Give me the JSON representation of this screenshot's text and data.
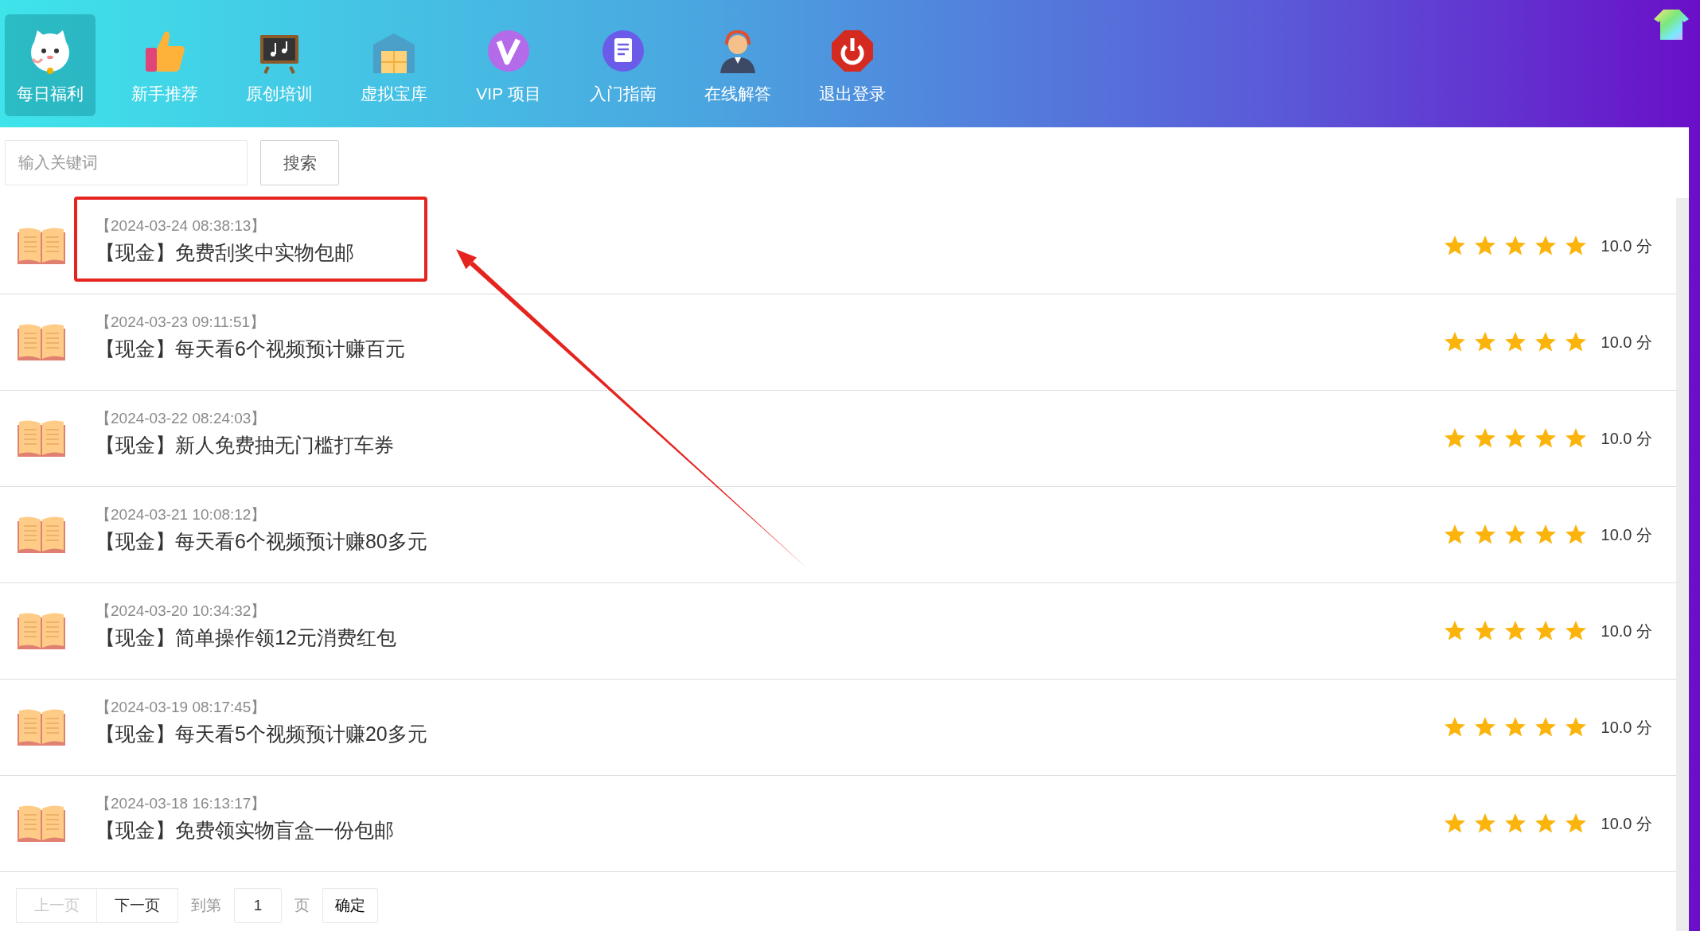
{
  "nav": {
    "items": [
      {
        "label": "每日福利",
        "selected": true
      },
      {
        "label": "新手推荐",
        "selected": false
      },
      {
        "label": "原创培训",
        "selected": false
      },
      {
        "label": "虚拟宝库",
        "selected": false
      },
      {
        "label": "VIP 项目",
        "selected": false
      },
      {
        "label": "入门指南",
        "selected": false
      },
      {
        "label": "在线解答",
        "selected": false
      },
      {
        "label": "退出登录",
        "selected": false
      }
    ]
  },
  "search": {
    "placeholder": "输入关键词",
    "button": "搜索"
  },
  "articles": [
    {
      "date": "【2024-03-24 08:38:13】",
      "title": "【现金】免费刮奖中实物包邮",
      "stars": 5,
      "score": "10.0 分",
      "highlighted": true
    },
    {
      "date": "【2024-03-23 09:11:51】",
      "title": "【现金】每天看6个视频预计赚百元",
      "stars": 5,
      "score": "10.0 分",
      "highlighted": false
    },
    {
      "date": "【2024-03-22 08:24:03】",
      "title": "【现金】新人免费抽无门槛打车券",
      "stars": 5,
      "score": "10.0 分",
      "highlighted": false
    },
    {
      "date": "【2024-03-21 10:08:12】",
      "title": "【现金】每天看6个视频预计赚80多元",
      "stars": 5,
      "score": "10.0 分",
      "highlighted": false
    },
    {
      "date": "【2024-03-20 10:34:32】",
      "title": "【现金】简单操作领12元消费红包",
      "stars": 5,
      "score": "10.0 分",
      "highlighted": false
    },
    {
      "date": "【2024-03-19 08:17:45】",
      "title": "【现金】每天看5个视频预计赚20多元",
      "stars": 5,
      "score": "10.0 分",
      "highlighted": false
    },
    {
      "date": "【2024-03-18 16:13:17】",
      "title": "【现金】免费领实物盲盒一份包邮",
      "stars": 5,
      "score": "10.0 分",
      "highlighted": false
    }
  ],
  "pagination": {
    "prev": {
      "label": "上一页",
      "disabled": true
    },
    "next": {
      "label": "下一页",
      "disabled": false
    },
    "goto_label": "到第",
    "page_value": "1",
    "page_unit": "页",
    "confirm": "确定"
  }
}
